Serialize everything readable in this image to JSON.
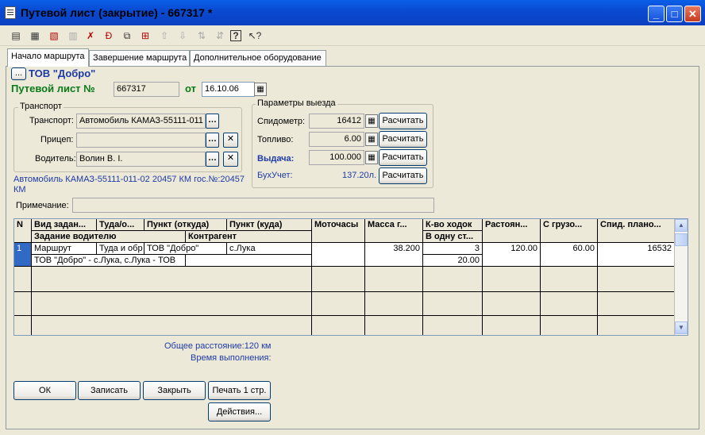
{
  "window": {
    "title": "Путевой лист (закрытие) - 667317 *",
    "minimize": "_",
    "maximize": "□",
    "close": "✕"
  },
  "toolbar": {
    "icons": [
      "new-row-icon",
      "new-row-copy-icon",
      "delete-row-icon",
      "edit-row-icon",
      "delete-mark-icon",
      "direct-delete-icon",
      "copy-icon",
      "insert-icon",
      "move-up-icon",
      "move-down-icon",
      "sort-asc-icon",
      "sort-desc-icon",
      "help-icon",
      "whats-this-icon"
    ]
  },
  "tabs": [
    "Начало маршрута",
    "Завершение маршрута",
    "Дополнительное оборудование"
  ],
  "header": {
    "select_btn": "...",
    "org_name": "ТОВ \"Добро\"",
    "doc_label": "Путевой лист №",
    "doc_number": "667317",
    "date_label": "от",
    "date_value": "16.10.06"
  },
  "transport": {
    "group_label": "Транспорт",
    "transport_label": "Транспорт:",
    "transport_value": "Автомобиль КАМАЗ-55111-011",
    "trailer_label": "Прицеп:",
    "trailer_value": "",
    "driver_label": "Водитель:",
    "driver_value": "Волин В. І.",
    "info_text": "Автомобиль КАМАЗ-55111-011-02 20457 КМ гос.№:20457 КМ"
  },
  "params": {
    "group_label": "Параметры выезда",
    "speedometer_label": "Спидометр:",
    "speedometer_value": "16412",
    "fuel_label": "Топливо:",
    "fuel_value": "6.00",
    "issue_label": "Выдача:",
    "issue_value": "100.000",
    "accounting_label": "БухУчет:",
    "accounting_value": "137.20л.",
    "calc_btn": "Расчитать"
  },
  "note": {
    "label": "Примечание:",
    "value": ""
  },
  "grid": {
    "headers_row1": [
      "N",
      "Вид задан...",
      "Туда/о...",
      "Пункт (откуда)",
      "Пункт (куда)",
      "Моточасы",
      "Масса г...",
      "К-во ходок",
      "Растоян...",
      "С грузо...",
      "Спид. плано..."
    ],
    "headers_row2": [
      "Задание водителю",
      "Контрагент",
      "В одну ст..."
    ],
    "row1": {
      "n": "1",
      "type": "Маршрут",
      "direction": "Туда и обр",
      "from": "ТОВ \"Добро\"",
      "to": "с.Лука",
      "moto": "",
      "mass": "38.200",
      "trips": "3",
      "distance": "120.00",
      "loaded": "60.00",
      "speedometer_plan": "16532"
    },
    "row1_sub": {
      "task": "ТОВ \"Добро\" - с.Лука,  с.Лука -  ТОВ",
      "contractor": "",
      "one_way": "20.00"
    }
  },
  "summary": {
    "total_distance": "Общее расстояние:120 км",
    "exec_time": "Время выполнения:"
  },
  "buttons": {
    "ok": "ОК",
    "save": "Записать",
    "close": "Закрыть",
    "print": "Печать 1 стр.",
    "actions": "Действия..."
  }
}
